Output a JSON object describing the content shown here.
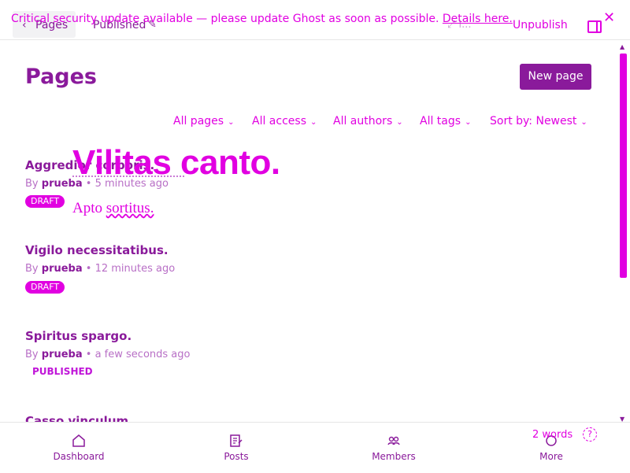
{
  "topbar": {
    "back_label": "Pages",
    "status_label": "Published",
    "unpublish_label": "Unpublish",
    "preview_mark": "⤢ l...",
    "banner_text": "Critical security update available — please update Ghost as soon as possible.",
    "banner_link": "Details here."
  },
  "main": {
    "title": "Pages",
    "new_page_label": "New page",
    "filters": [
      {
        "label": "All pages"
      },
      {
        "label": "All access"
      },
      {
        "label": "All authors"
      },
      {
        "label": "All tags"
      },
      {
        "label": "Sort by: Newest"
      }
    ],
    "items": [
      {
        "title": "Aggredior corporis.",
        "by": "By",
        "author": "prueba",
        "time": "• 5 minutes ago",
        "badge": "DRAFT"
      },
      {
        "title": "Vigilo necessitatibus.",
        "by": "By",
        "author": "prueba",
        "time": "• 12 minutes ago",
        "badge": "DRAFT"
      },
      {
        "title": "Spiritus spargo.",
        "by": "By",
        "author": "prueba",
        "time": "• a few seconds ago",
        "badge": "PUBLISHED"
      },
      {
        "title": "Casso vinculum."
      }
    ]
  },
  "overlay": {
    "big_text": "Vilitas canto.",
    "small_prefix": "Apto",
    "small_link": "sortitus."
  },
  "bottom_nav": {
    "items": [
      {
        "label": "Dashboard",
        "icon": "home-icon"
      },
      {
        "label": "Posts",
        "icon": "posts-icon"
      },
      {
        "label": "Members",
        "icon": "members-icon"
      },
      {
        "label": "More",
        "icon": "more-icon"
      }
    ],
    "word_count": "2 words",
    "help_glyph": "?"
  },
  "colors": {
    "accent": "#e100e1",
    "brand": "#8a1a9b",
    "background": "#ffffff"
  }
}
